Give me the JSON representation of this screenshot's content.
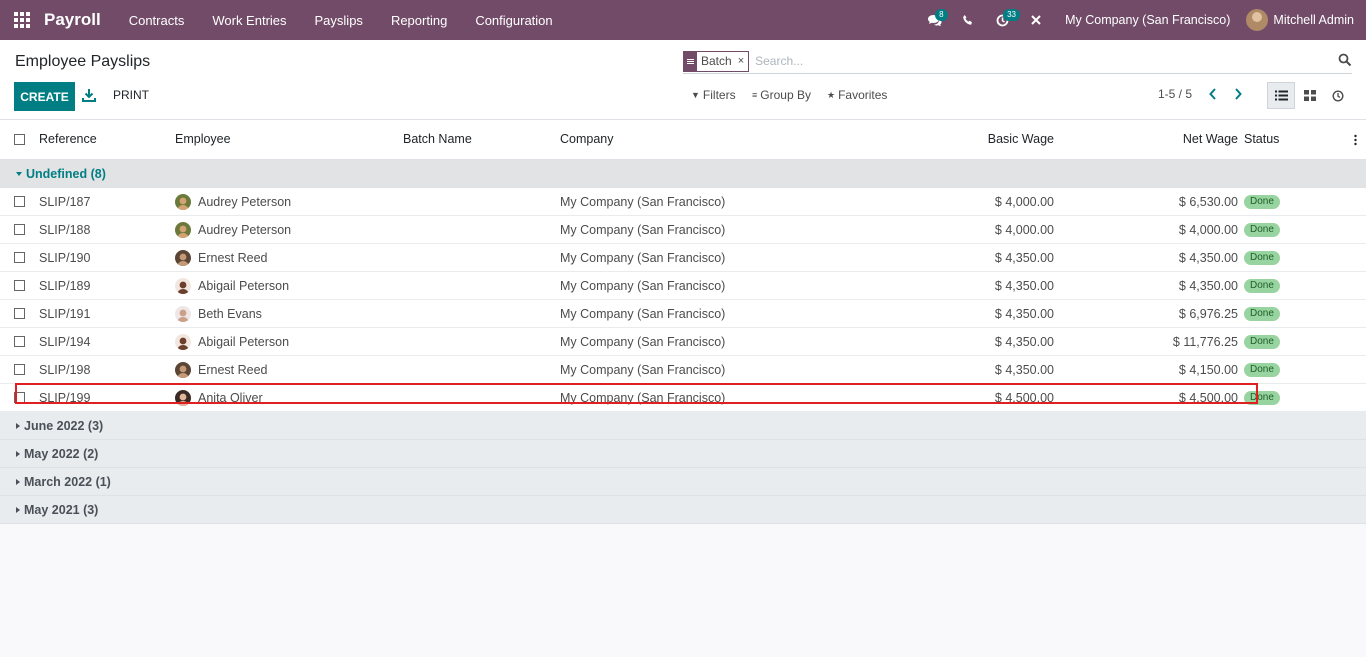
{
  "navbar": {
    "app_name": "Payroll",
    "menu": [
      "Contracts",
      "Work Entries",
      "Payslips",
      "Reporting",
      "Configuration"
    ],
    "messages_badge": "8",
    "activities_badge": "33",
    "company": "My Company (San Francisco)",
    "user": "Mitchell Admin"
  },
  "control": {
    "title": "Employee Payslips",
    "create_label": "CREATE",
    "print_label": "PRINT",
    "facet_value": "Batch",
    "facet_close": "×",
    "search_placeholder": "Search...",
    "filters_label": "Filters",
    "group_by_label": "Group By",
    "favorites_label": "Favorites",
    "pager": "1-5 / 5"
  },
  "columns": {
    "reference": "Reference",
    "employee": "Employee",
    "batch_name": "Batch Name",
    "company": "Company",
    "basic_wage": "Basic Wage",
    "net_wage": "Net Wage",
    "status": "Status"
  },
  "open_group": {
    "label": "Undefined (8)",
    "rows": [
      {
        "reference": "SLIP/187",
        "employee": "Audrey Peterson",
        "company": "My Company (San Francisco)",
        "basic_wage": "$ 4,000.00",
        "net_wage": "$ 6,530.00",
        "status": "Done"
      },
      {
        "reference": "SLIP/188",
        "employee": "Audrey Peterson",
        "company": "My Company (San Francisco)",
        "basic_wage": "$ 4,000.00",
        "net_wage": "$ 4,000.00",
        "status": "Done"
      },
      {
        "reference": "SLIP/190",
        "employee": "Ernest Reed",
        "company": "My Company (San Francisco)",
        "basic_wage": "$ 4,350.00",
        "net_wage": "$ 4,350.00",
        "status": "Done"
      },
      {
        "reference": "SLIP/189",
        "employee": "Abigail Peterson",
        "company": "My Company (San Francisco)",
        "basic_wage": "$ 4,350.00",
        "net_wage": "$ 4,350.00",
        "status": "Done"
      },
      {
        "reference": "SLIP/191",
        "employee": "Beth Evans",
        "company": "My Company (San Francisco)",
        "basic_wage": "$ 4,350.00",
        "net_wage": "$ 6,976.25",
        "status": "Done"
      },
      {
        "reference": "SLIP/194",
        "employee": "Abigail Peterson",
        "company": "My Company (San Francisco)",
        "basic_wage": "$ 4,350.00",
        "net_wage": "$ 11,776.25",
        "status": "Done"
      },
      {
        "reference": "SLIP/198",
        "employee": "Ernest Reed",
        "company": "My Company (San Francisco)",
        "basic_wage": "$ 4,350.00",
        "net_wage": "$ 4,150.00",
        "status": "Done"
      },
      {
        "reference": "SLIP/199",
        "employee": "Anita Oliver",
        "company": "My Company (San Francisco)",
        "basic_wage": "$ 4,500.00",
        "net_wage": "$ 4,500.00",
        "status": "Done"
      }
    ]
  },
  "collapsed_groups": [
    "June 2022 (3)",
    "May 2022 (2)",
    "March 2022 (1)",
    "May 2021 (3)"
  ],
  "colors": {
    "navbar": "#714b67",
    "primary": "#017e84",
    "status_done": "#98d4a0",
    "highlight": "#e02020"
  }
}
